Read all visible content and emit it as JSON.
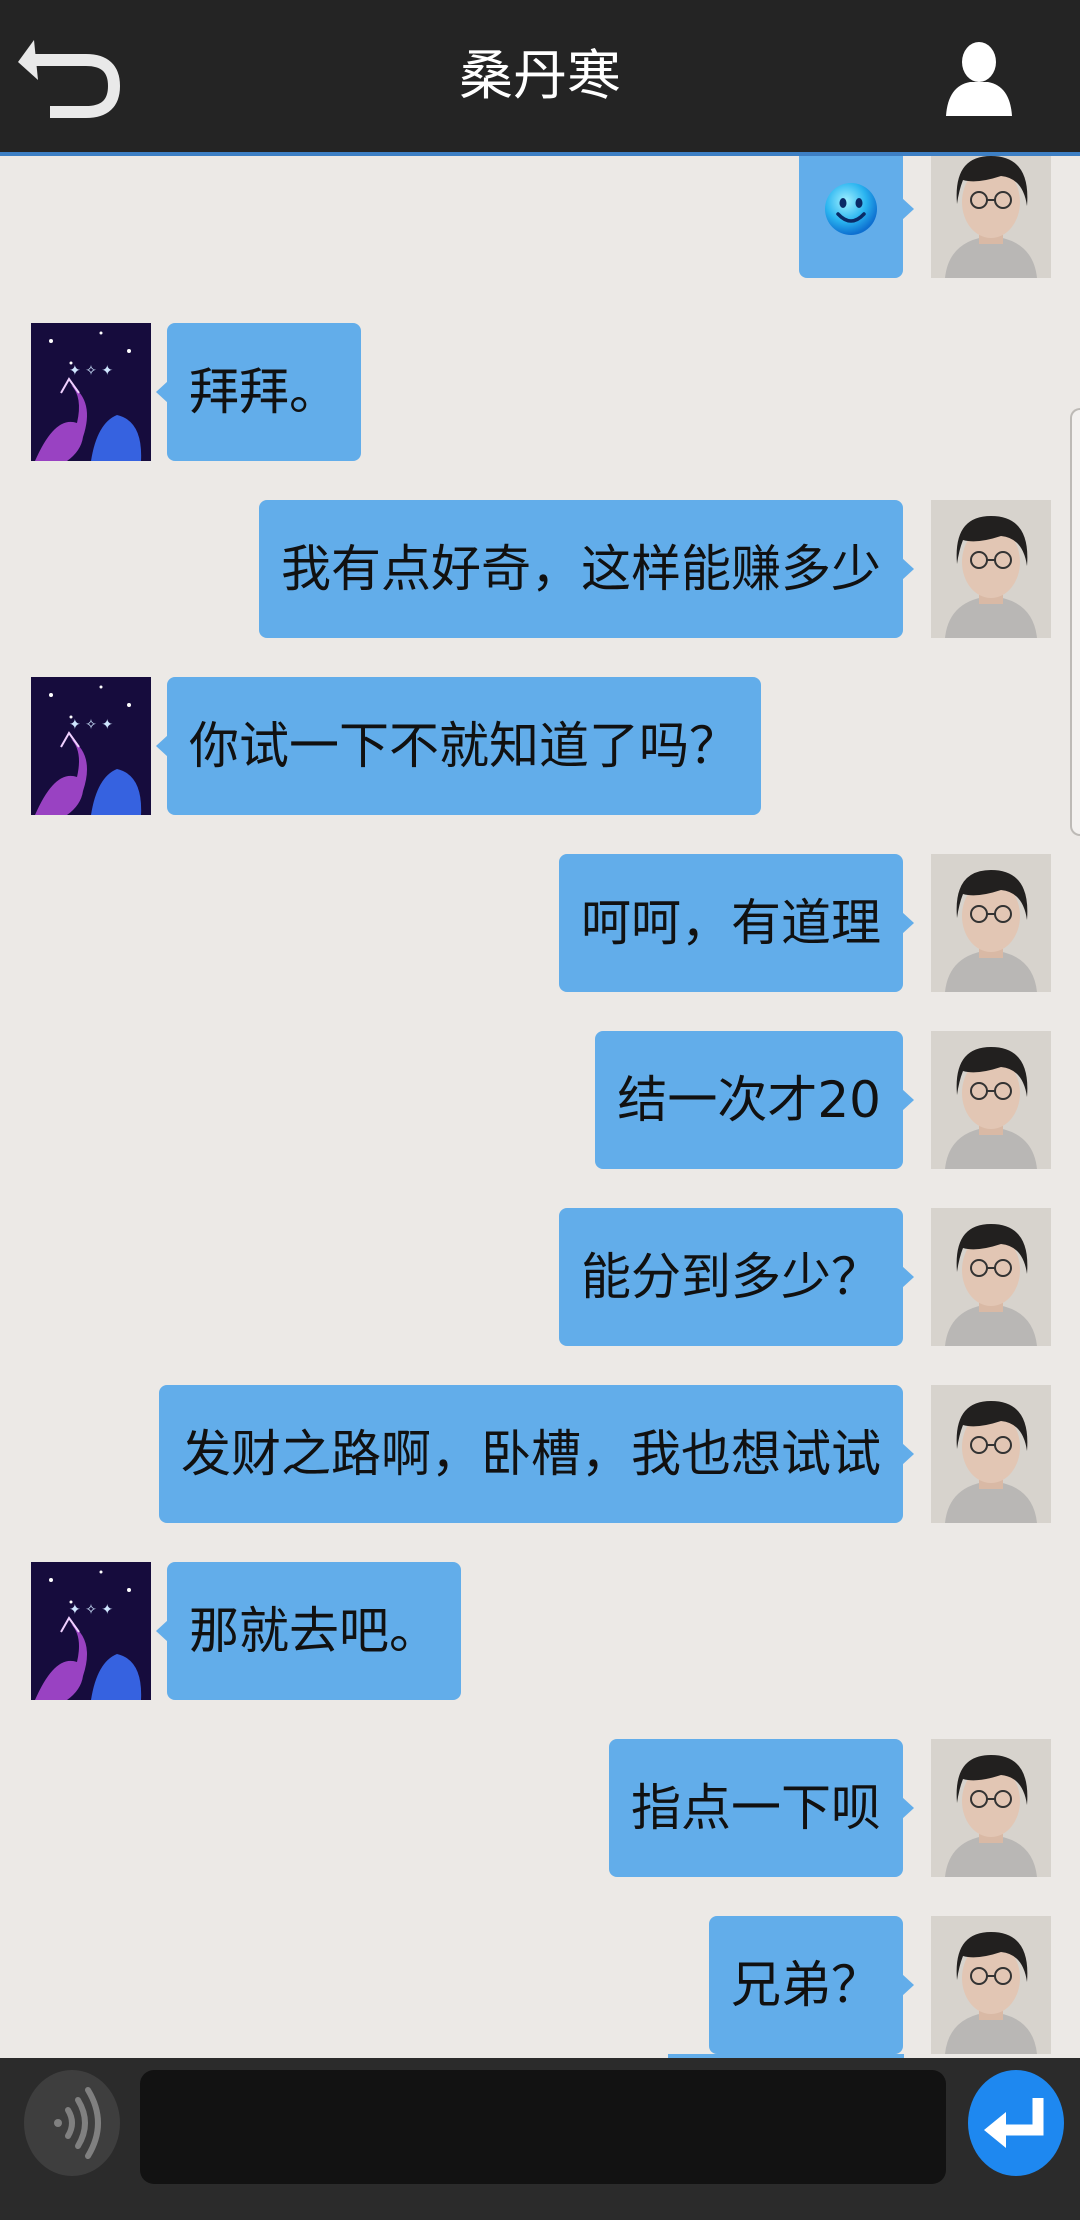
{
  "header": {
    "title": "桑丹寒"
  },
  "messages": [
    {
      "sender": "me",
      "type": "emoji",
      "icon": "smiley-icon"
    },
    {
      "sender": "other",
      "text": "拜拜。"
    },
    {
      "sender": "me",
      "text": "我有点好奇，这样能赚多少"
    },
    {
      "sender": "other",
      "text": "你试一下不就知道了吗？"
    },
    {
      "sender": "me",
      "text": "呵呵，有道理"
    },
    {
      "sender": "me",
      "text": "结一次才20"
    },
    {
      "sender": "me",
      "text": "能分到多少？"
    },
    {
      "sender": "me",
      "text": "发财之路啊，卧槽，我也想试试"
    },
    {
      "sender": "other",
      "text": "那就去吧。"
    },
    {
      "sender": "me",
      "text": "指点一下呗"
    },
    {
      "sender": "me",
      "text": "兄弟？"
    }
  ],
  "input": {
    "value": "",
    "placeholder": ""
  },
  "colors": {
    "topbar": "#242424",
    "accent_line": "#3d7fc4",
    "bubble": "#62adea",
    "chat_bg": "#ece9e6",
    "send_button": "#1e88f0"
  }
}
